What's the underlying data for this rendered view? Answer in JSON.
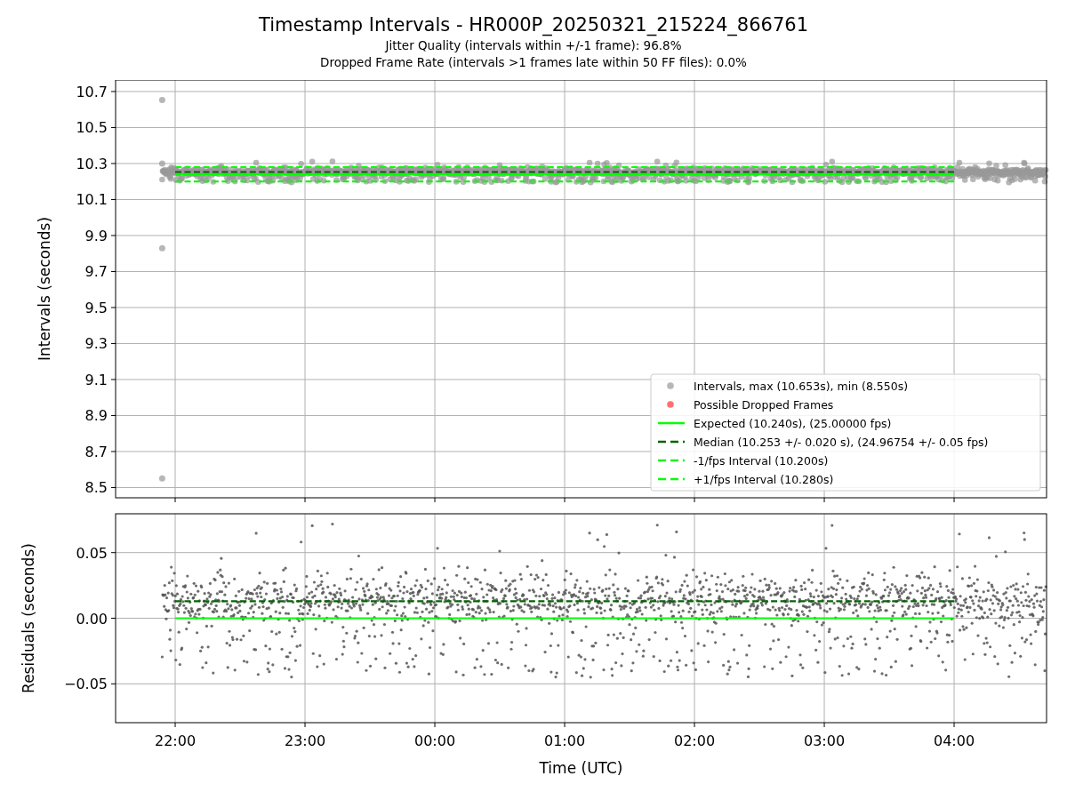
{
  "figure": {
    "title": "Timestamp Intervals - HR000P_20250321_215224_866761",
    "subtitles": [
      "Jitter Quality (intervals within +/-1 frame): 96.8%",
      "Dropped Frame Rate (intervals >1 frames late within 50 FF files): 0.0%"
    ]
  },
  "charts": [
    {
      "chart_data": {
        "type": "line",
        "ylabel": "Intervals (seconds)",
        "grid": true,
        "legend": true,
        "ylim": [
          8.443,
          10.764
        ],
        "yticks": [
          {
            "value": 8.5,
            "label": "8.5"
          },
          {
            "value": 8.7,
            "label": "8.7"
          },
          {
            "value": 8.9,
            "label": "8.9"
          },
          {
            "value": 9.1,
            "label": "9.1"
          },
          {
            "value": 9.3,
            "label": "9.3"
          },
          {
            "value": 9.5,
            "label": "9.5"
          },
          {
            "value": 9.7,
            "label": "9.7"
          },
          {
            "value": 9.9,
            "label": "9.9"
          },
          {
            "value": 10.1,
            "label": "10.1"
          },
          {
            "value": 10.3,
            "label": "10.3"
          },
          {
            "value": 10.5,
            "label": "10.5"
          },
          {
            "value": 10.7,
            "label": "10.7"
          }
        ],
        "series": [
          {
            "name": "Intervals, max (10.653s), min (8.550s)",
            "type": "scatter",
            "color": "#999999"
          },
          {
            "name": "Possible Dropped Frames",
            "type": "scatter",
            "color": "#ff3333"
          },
          {
            "name": "Expected (10.240s), (25.00000 fps)",
            "type": "line",
            "line_style": "solid",
            "color": "#00ff00",
            "values": [
              10.24,
              10.24,
              10.24,
              10.24,
              10.24,
              10.24,
              10.24
            ]
          },
          {
            "name": "Median (10.253 +/- 0.020 s), (24.96754 +/- 0.05 fps)",
            "type": "line",
            "line_style": "dashed",
            "color": "#006400",
            "values": [
              10.253,
              10.253,
              10.253,
              10.253,
              10.253,
              10.253,
              10.253
            ]
          },
          {
            "name": "-1/fps Interval (10.200s)",
            "type": "line",
            "line_style": "dashed",
            "color": "#22ee22",
            "values": [
              10.2,
              10.2,
              10.2,
              10.2,
              10.2,
              10.2,
              10.2
            ]
          },
          {
            "name": "+1/fps Interval (10.280s)",
            "type": "line",
            "line_style": "dashed",
            "color": "#00ff00",
            "values": [
              10.28,
              10.28,
              10.28,
              10.28,
              10.28,
              10.28,
              10.28
            ]
          }
        ]
      }
    },
    {
      "chart_data": {
        "type": "line",
        "xlabel": "Time (UTC)",
        "ylabel": "Residuals (seconds)",
        "grid": true,
        "ylim": [
          -0.0796,
          0.0796
        ],
        "categories": [
          "22:00",
          "23:00",
          "00:00",
          "01:00",
          "02:00",
          "03:00",
          "04:00"
        ],
        "yticks": [
          {
            "value": -0.05,
            "label": "−0.05"
          },
          {
            "value": 0,
            "label": "0.00"
          },
          {
            "value": 0.05,
            "label": "0.05"
          }
        ],
        "series": [
          {
            "type": "line",
            "line_style": "solid",
            "color": "#00ff00",
            "values": [
              0,
              0,
              0,
              0,
              0,
              0,
              0
            ]
          },
          {
            "type": "line",
            "line_style": "dashed",
            "color": "#006400",
            "values": [
              0.013,
              0.013,
              0.013,
              0.013,
              0.013,
              0.013,
              0.013
            ]
          }
        ]
      }
    }
  ]
}
